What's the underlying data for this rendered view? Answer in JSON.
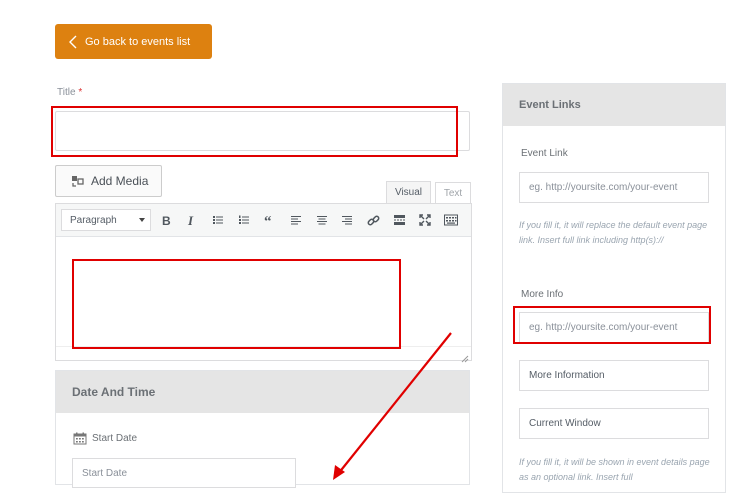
{
  "back_button": {
    "label": "Go back to events list"
  },
  "title_field": {
    "label": "Title",
    "required_mark": "*",
    "value": ""
  },
  "editor": {
    "add_media_label": "Add Media",
    "tab_visual": "Visual",
    "tab_text": "Text",
    "format_select": "Paragraph",
    "toolbar_icons": [
      "bold-icon",
      "italic-icon",
      "bullet-list-icon",
      "numbered-list-icon",
      "blockquote-icon",
      "align-left-icon",
      "align-center-icon",
      "align-right-icon",
      "link-icon",
      "read-more-icon",
      "fullscreen-icon",
      "toolbar-toggle-icon"
    ],
    "content": ""
  },
  "date_panel": {
    "title": "Date And Time",
    "start_date_label": "Start Date",
    "start_date_placeholder": "Start Date"
  },
  "links_panel": {
    "title": "Event Links",
    "event_link_label": "Event Link",
    "event_link_placeholder": "eg. http://yoursite.com/your-event",
    "event_link_help": "If you fill it, it will replace the default event page link. Insert full link including http(s)://",
    "more_info_label": "More Info",
    "more_info_placeholder": "eg. http://yoursite.com/your-event",
    "more_info_title": "More Information",
    "more_info_target": "Current Window",
    "more_info_help": "If you fill it, it will be shown in event details page as an optional link. Insert full"
  },
  "colors": {
    "accent": "#dd8110",
    "annotation": "#e00000",
    "panel_header": "#e5e5e5"
  }
}
